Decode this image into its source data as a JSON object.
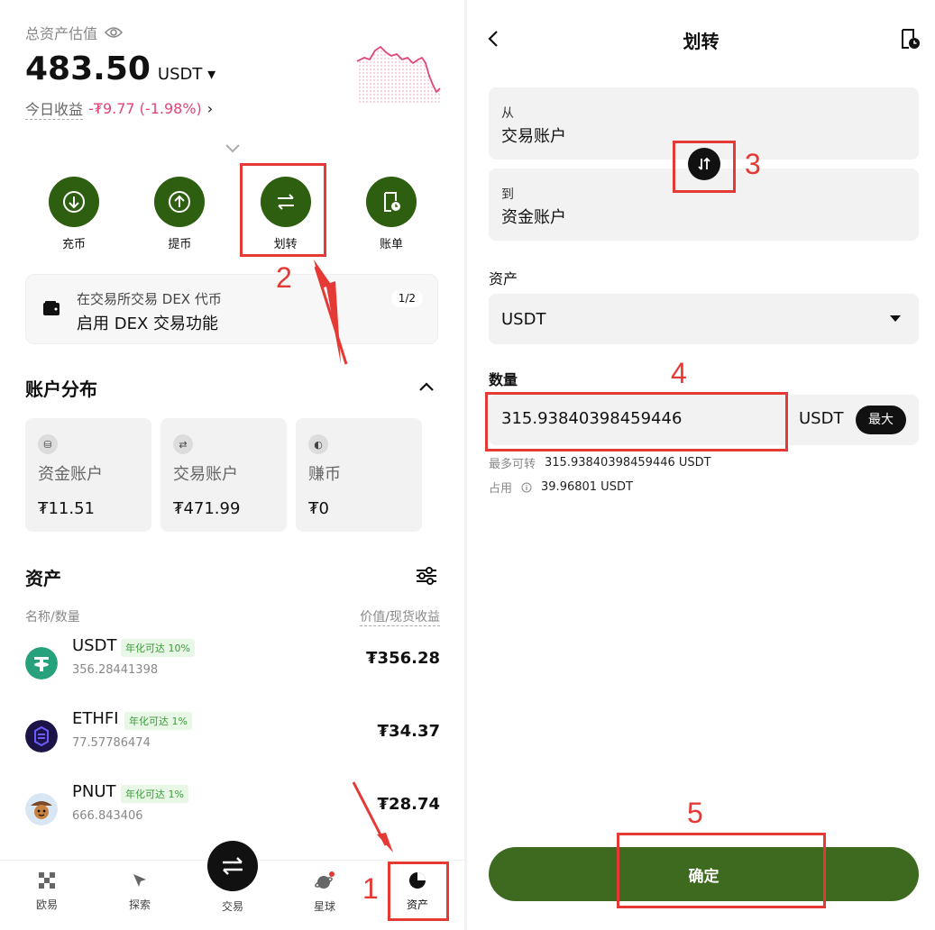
{
  "left": {
    "estimate_label": "总资产估值",
    "total_value": "483.50",
    "total_unit": "USDT",
    "today_label": "今日收益",
    "today_pnl": "-₮9.77 (-1.98%)",
    "actions": [
      {
        "label": "充币",
        "icon": "deposit-icon"
      },
      {
        "label": "提币",
        "icon": "withdraw-icon"
      },
      {
        "label": "划转",
        "icon": "transfer-icon"
      },
      {
        "label": "账单",
        "icon": "bill-icon"
      }
    ],
    "banner": {
      "line1": "在交易所交易 DEX 代币",
      "line2": "启用 DEX 交易功能",
      "page": "1/2"
    },
    "account_dist_title": "账户分布",
    "accounts": [
      {
        "name": "资金账户",
        "value": "₮11.51",
        "icon": "funding-icon"
      },
      {
        "name": "交易账户",
        "value": "₮471.99",
        "icon": "trading-icon"
      },
      {
        "name": "赚币",
        "value": "₮0",
        "icon": "earn-icon"
      }
    ],
    "assets_title": "资产",
    "col_left": "名称/数量",
    "col_right": "价值/现货收益",
    "assets": [
      {
        "symbol": "USDT",
        "tag": "年化可达 10%",
        "qty": "356.28441398",
        "value": "₮356.28",
        "color": "#26a17b"
      },
      {
        "symbol": "ETHFI",
        "tag": "年化可达 1%",
        "qty": "77.57786474",
        "value": "₮34.37",
        "color": "#1c1446"
      },
      {
        "symbol": "PNUT",
        "tag": "年化可达 1%",
        "qty": "666.843406",
        "value": "₮28.74",
        "color": "#d9e7f5"
      }
    ],
    "nav": [
      {
        "label": "欧易",
        "icon": "okx-icon"
      },
      {
        "label": "探索",
        "icon": "explore-icon"
      },
      {
        "label": "交易",
        "icon": "trade-icon"
      },
      {
        "label": "星球",
        "icon": "planet-icon"
      },
      {
        "label": "资产",
        "icon": "assets-icon"
      }
    ]
  },
  "right": {
    "title": "划转",
    "from_label": "从",
    "from_value": "交易账户",
    "to_label": "到",
    "to_value": "资金账户",
    "asset_label": "资产",
    "asset_value": "USDT",
    "amount_label": "数量",
    "amount_value": "315.93840398459446",
    "amount_unit": "USDT",
    "max_label": "最大",
    "max_transferable_label": "最多可转",
    "max_transferable_value": "315.93840398459446 USDT",
    "occupied_label": "占用",
    "occupied_value": "39.96801 USDT",
    "confirm_label": "确定"
  },
  "annotations": [
    "1",
    "2",
    "3",
    "4",
    "5"
  ],
  "colors": {
    "accent": "#2e5e10",
    "confirm": "#3e6a1f",
    "negative": "#e0457a",
    "annotation": "#e53935"
  }
}
